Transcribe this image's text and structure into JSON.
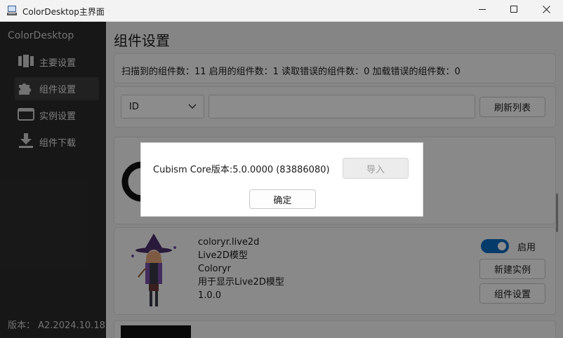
{
  "window": {
    "title": "ColorDesktop主界面",
    "controls": [
      "minimize-icon",
      "maximize-icon",
      "close-icon"
    ]
  },
  "sidebar": {
    "brand": "ColorDesktop",
    "items": [
      {
        "label": "主要设置",
        "icon": "main-settings-icon"
      },
      {
        "label": "组件设置",
        "icon": "puzzle-icon",
        "active": true
      },
      {
        "label": "实例设置",
        "icon": "window-icon"
      },
      {
        "label": "组件下载",
        "icon": "download-icon"
      }
    ],
    "version": "版本： A2.2024.10.18"
  },
  "main": {
    "title": "组件设置",
    "stats": "扫描到的组件数：11  启用的组件数：1  读取错误的组件数：0  加载错误的组件数：0",
    "filter": {
      "selected": "ID",
      "search_value": "",
      "refresh_label": "刷新列表"
    },
    "component": {
      "id": "coloryr.live2d",
      "name": "Live2D模型",
      "author": "Coloryr",
      "description": "用于显示Live2D模型",
      "version": "1.0.0",
      "enabled": true,
      "toggle_label": "启用",
      "new_instance_label": "新建实例",
      "settings_label": "组件设置"
    }
  },
  "dialog": {
    "core_version": "Cubism Core版本:5.0.0000 (83886080)",
    "import_label": "导入",
    "ok_label": "确定"
  },
  "colors": {
    "accent": "#0a6cc4",
    "sidebar_bg": "#2b2b2b",
    "overlay": "rgba(0,0,0,0.45)"
  }
}
